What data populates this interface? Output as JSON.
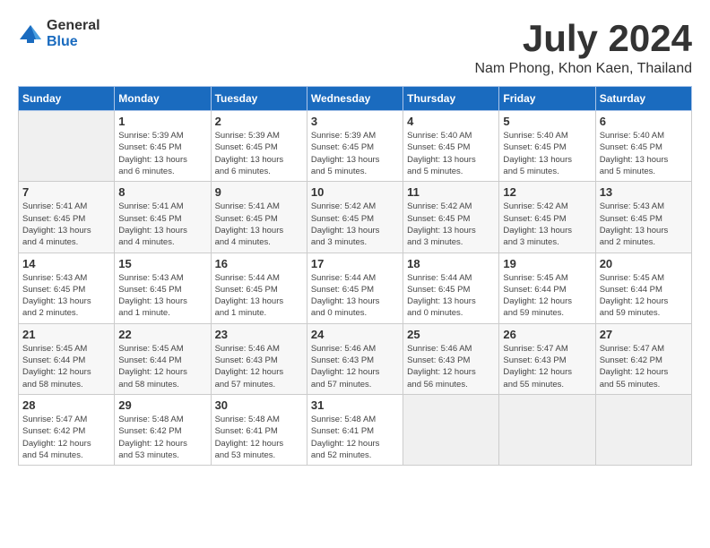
{
  "logo": {
    "general": "General",
    "blue": "Blue"
  },
  "title": "July 2024",
  "location": "Nam Phong, Khon Kaen, Thailand",
  "days_of_week": [
    "Sunday",
    "Monday",
    "Tuesday",
    "Wednesday",
    "Thursday",
    "Friday",
    "Saturday"
  ],
  "weeks": [
    [
      {
        "day": "",
        "info": ""
      },
      {
        "day": "1",
        "info": "Sunrise: 5:39 AM\nSunset: 6:45 PM\nDaylight: 13 hours\nand 6 minutes."
      },
      {
        "day": "2",
        "info": "Sunrise: 5:39 AM\nSunset: 6:45 PM\nDaylight: 13 hours\nand 6 minutes."
      },
      {
        "day": "3",
        "info": "Sunrise: 5:39 AM\nSunset: 6:45 PM\nDaylight: 13 hours\nand 5 minutes."
      },
      {
        "day": "4",
        "info": "Sunrise: 5:40 AM\nSunset: 6:45 PM\nDaylight: 13 hours\nand 5 minutes."
      },
      {
        "day": "5",
        "info": "Sunrise: 5:40 AM\nSunset: 6:45 PM\nDaylight: 13 hours\nand 5 minutes."
      },
      {
        "day": "6",
        "info": "Sunrise: 5:40 AM\nSunset: 6:45 PM\nDaylight: 13 hours\nand 5 minutes."
      }
    ],
    [
      {
        "day": "7",
        "info": "Sunrise: 5:41 AM\nSunset: 6:45 PM\nDaylight: 13 hours\nand 4 minutes."
      },
      {
        "day": "8",
        "info": "Sunrise: 5:41 AM\nSunset: 6:45 PM\nDaylight: 13 hours\nand 4 minutes."
      },
      {
        "day": "9",
        "info": "Sunrise: 5:41 AM\nSunset: 6:45 PM\nDaylight: 13 hours\nand 4 minutes."
      },
      {
        "day": "10",
        "info": "Sunrise: 5:42 AM\nSunset: 6:45 PM\nDaylight: 13 hours\nand 3 minutes."
      },
      {
        "day": "11",
        "info": "Sunrise: 5:42 AM\nSunset: 6:45 PM\nDaylight: 13 hours\nand 3 minutes."
      },
      {
        "day": "12",
        "info": "Sunrise: 5:42 AM\nSunset: 6:45 PM\nDaylight: 13 hours\nand 3 minutes."
      },
      {
        "day": "13",
        "info": "Sunrise: 5:43 AM\nSunset: 6:45 PM\nDaylight: 13 hours\nand 2 minutes."
      }
    ],
    [
      {
        "day": "14",
        "info": "Sunrise: 5:43 AM\nSunset: 6:45 PM\nDaylight: 13 hours\nand 2 minutes."
      },
      {
        "day": "15",
        "info": "Sunrise: 5:43 AM\nSunset: 6:45 PM\nDaylight: 13 hours\nand 1 minute."
      },
      {
        "day": "16",
        "info": "Sunrise: 5:44 AM\nSunset: 6:45 PM\nDaylight: 13 hours\nand 1 minute."
      },
      {
        "day": "17",
        "info": "Sunrise: 5:44 AM\nSunset: 6:45 PM\nDaylight: 13 hours\nand 0 minutes."
      },
      {
        "day": "18",
        "info": "Sunrise: 5:44 AM\nSunset: 6:45 PM\nDaylight: 13 hours\nand 0 minutes."
      },
      {
        "day": "19",
        "info": "Sunrise: 5:45 AM\nSunset: 6:44 PM\nDaylight: 12 hours\nand 59 minutes."
      },
      {
        "day": "20",
        "info": "Sunrise: 5:45 AM\nSunset: 6:44 PM\nDaylight: 12 hours\nand 59 minutes."
      }
    ],
    [
      {
        "day": "21",
        "info": "Sunrise: 5:45 AM\nSunset: 6:44 PM\nDaylight: 12 hours\nand 58 minutes."
      },
      {
        "day": "22",
        "info": "Sunrise: 5:45 AM\nSunset: 6:44 PM\nDaylight: 12 hours\nand 58 minutes."
      },
      {
        "day": "23",
        "info": "Sunrise: 5:46 AM\nSunset: 6:43 PM\nDaylight: 12 hours\nand 57 minutes."
      },
      {
        "day": "24",
        "info": "Sunrise: 5:46 AM\nSunset: 6:43 PM\nDaylight: 12 hours\nand 57 minutes."
      },
      {
        "day": "25",
        "info": "Sunrise: 5:46 AM\nSunset: 6:43 PM\nDaylight: 12 hours\nand 56 minutes."
      },
      {
        "day": "26",
        "info": "Sunrise: 5:47 AM\nSunset: 6:43 PM\nDaylight: 12 hours\nand 55 minutes."
      },
      {
        "day": "27",
        "info": "Sunrise: 5:47 AM\nSunset: 6:42 PM\nDaylight: 12 hours\nand 55 minutes."
      }
    ],
    [
      {
        "day": "28",
        "info": "Sunrise: 5:47 AM\nSunset: 6:42 PM\nDaylight: 12 hours\nand 54 minutes."
      },
      {
        "day": "29",
        "info": "Sunrise: 5:48 AM\nSunset: 6:42 PM\nDaylight: 12 hours\nand 53 minutes."
      },
      {
        "day": "30",
        "info": "Sunrise: 5:48 AM\nSunset: 6:41 PM\nDaylight: 12 hours\nand 53 minutes."
      },
      {
        "day": "31",
        "info": "Sunrise: 5:48 AM\nSunset: 6:41 PM\nDaylight: 12 hours\nand 52 minutes."
      },
      {
        "day": "",
        "info": ""
      },
      {
        "day": "",
        "info": ""
      },
      {
        "day": "",
        "info": ""
      }
    ]
  ]
}
